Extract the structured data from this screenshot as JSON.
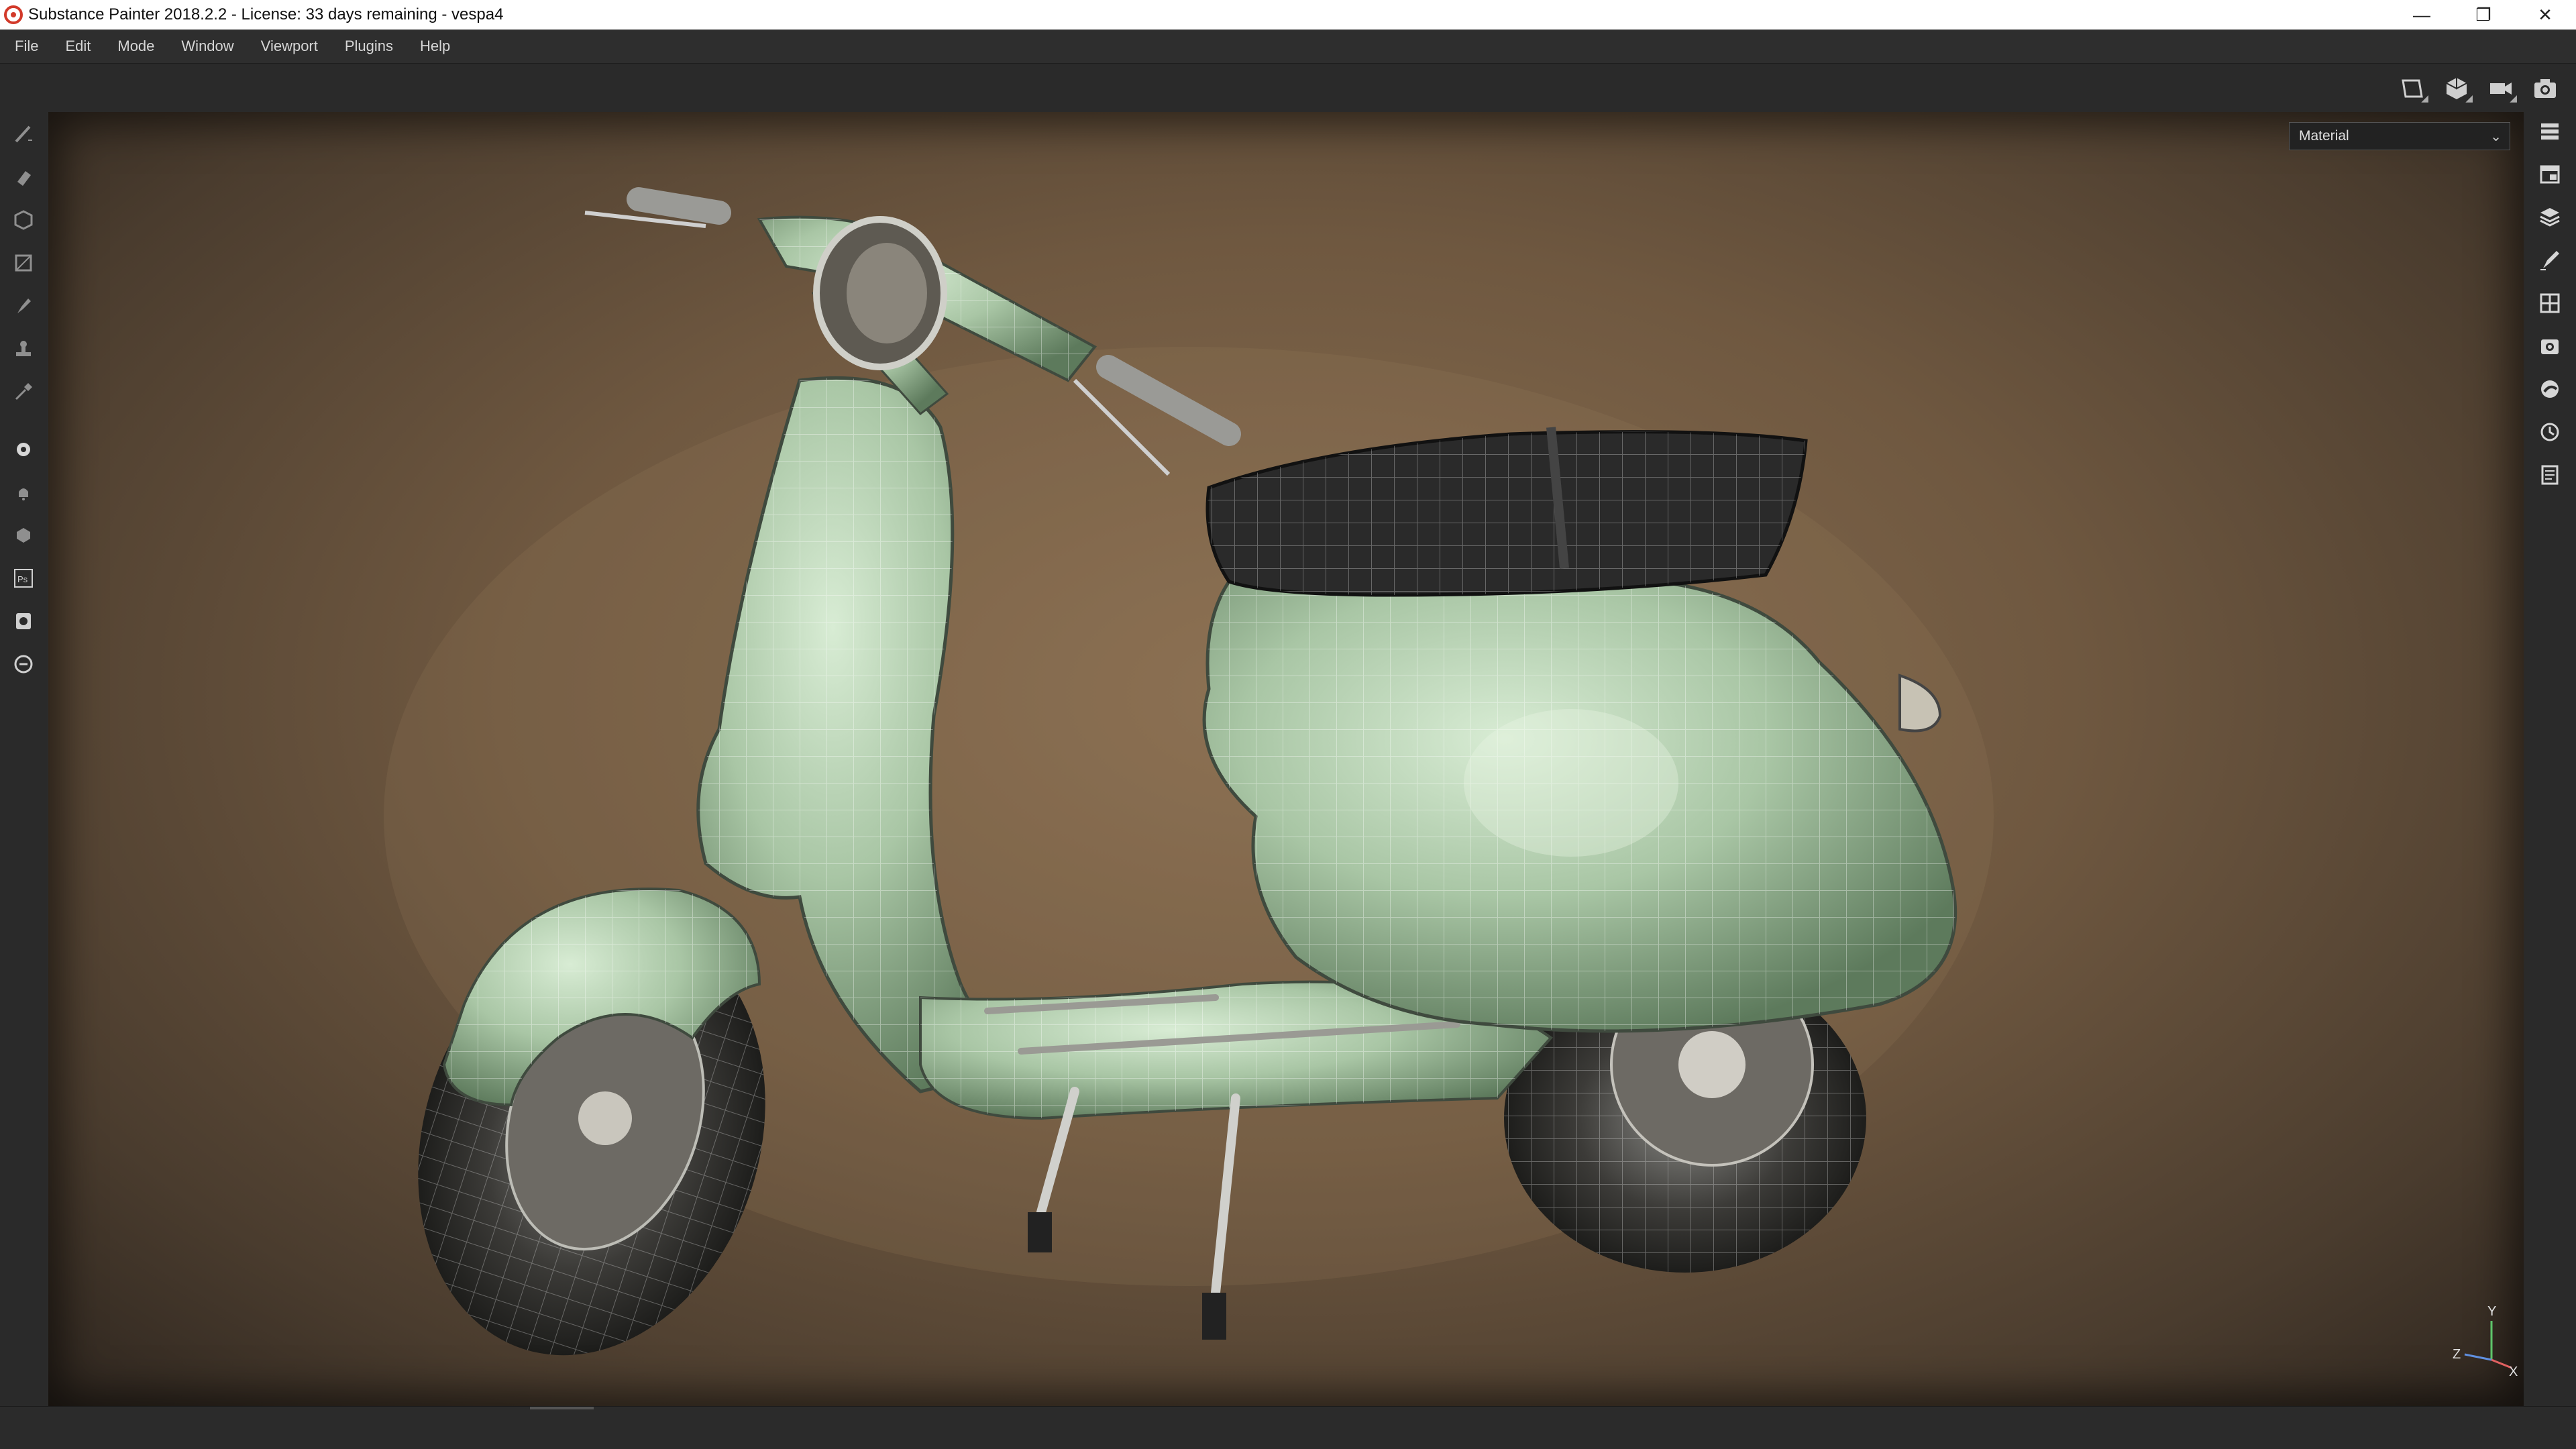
{
  "window": {
    "title": "Substance Painter 2018.2.2 - License: 33 days remaining - vespa4",
    "controls": {
      "minimize": "—",
      "restore": "❐",
      "close": "✕"
    }
  },
  "menu": {
    "items": [
      "File",
      "Edit",
      "Mode",
      "Window",
      "Viewport",
      "Plugins",
      "Help"
    ]
  },
  "top_toolbar": {
    "icons": [
      "2d-view-icon",
      "3d-view-icon",
      "camera-icon",
      "screenshot-icon"
    ]
  },
  "left_toolbar": {
    "icons": [
      "paint-brush-icon",
      "eraser-icon",
      "projection-icon",
      "polygon-fill-icon",
      "smudge-icon",
      "clone-stamp-icon",
      "color-picker-icon",
      "bake-icon",
      "notification-icon",
      "iray-icon",
      "photoshop-export-icon",
      "sketchfab-icon",
      "substance-share-icon"
    ]
  },
  "right_toolbar": {
    "icons": [
      "layers-icon",
      "texture-set-list-icon",
      "texture-set-settings-icon",
      "properties-icon",
      "display-settings-icon",
      "viewer-settings-icon",
      "shader-settings-icon",
      "history-icon",
      "log-icon"
    ]
  },
  "viewport": {
    "channel_select": {
      "value": "Material"
    },
    "axis": {
      "y": "Y",
      "z": "Z",
      "x": "X"
    }
  },
  "colors": {
    "scooter_body": "#a9c6a5",
    "seat": "#2a2a2a",
    "background_center": "#8a6f52",
    "background_edge": "#2e261f"
  }
}
